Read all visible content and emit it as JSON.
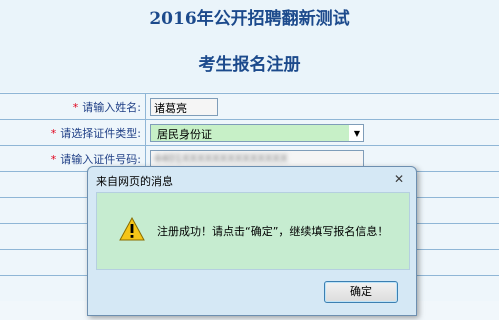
{
  "header": {
    "title": "2016年公开招聘翻新测试",
    "subtitle": "考生报名注册"
  },
  "form": {
    "required_mark": "*",
    "name_label": "请输入姓名:",
    "name_value": "诸葛亮",
    "idtype_label": "请选择证件类型:",
    "idtype_value": "居民身份证",
    "idnum_label": "请输入证件号码:",
    "idnum_value": "4401XXXXXXXXXXXXXX"
  },
  "dialog": {
    "title": "来自网页的消息",
    "message": "注册成功！请点击“确定”，继续填写报名信息！",
    "ok_label": "确定",
    "close_label": "✕"
  },
  "colors": {
    "title": "#1c4a8c",
    "label": "#1f3f86",
    "required": "#e0001b",
    "select_highlight": "#c7f0c7",
    "dialog_body": "#c6ecd0"
  }
}
